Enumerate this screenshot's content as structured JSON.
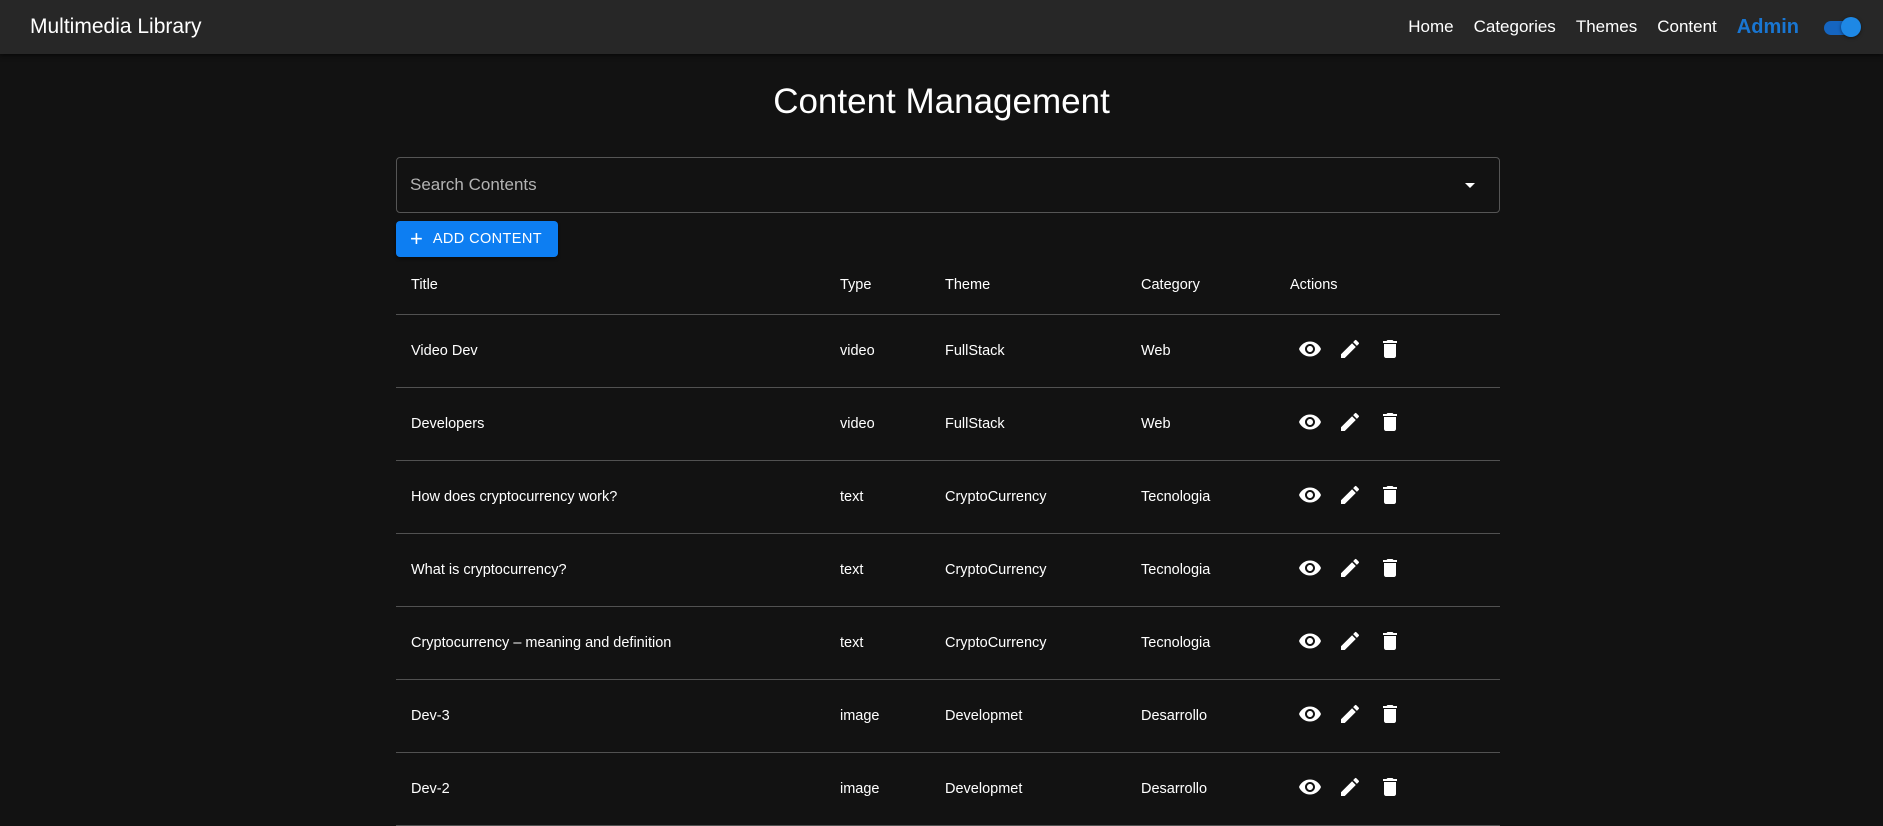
{
  "appbar": {
    "brand": "Multimedia Library",
    "nav": [
      "Home",
      "Categories",
      "Themes",
      "Content"
    ],
    "admin_label": "Admin",
    "theme_toggle_on": true
  },
  "page": {
    "title": "Content Management"
  },
  "search": {
    "placeholder": "Search Contents"
  },
  "add_button": {
    "icon": "plus-icon",
    "label": "ADD CONTENT"
  },
  "table": {
    "headers": [
      "Title",
      "Type",
      "Theme",
      "Category",
      "Actions"
    ],
    "action_icons": [
      "eye-icon",
      "pencil-icon",
      "trash-icon"
    ],
    "rows": [
      {
        "title": "Video Dev",
        "type": "video",
        "theme": "FullStack",
        "category": "Web"
      },
      {
        "title": "Developers",
        "type": "video",
        "theme": "FullStack",
        "category": "Web"
      },
      {
        "title": "How does cryptocurrency work?",
        "type": "text",
        "theme": "CryptoCurrency",
        "category": "Tecnologia"
      },
      {
        "title": "What is cryptocurrency?",
        "type": "text",
        "theme": "CryptoCurrency",
        "category": "Tecnologia"
      },
      {
        "title": "Cryptocurrency – meaning and definition",
        "type": "text",
        "theme": "CryptoCurrency",
        "category": "Tecnologia"
      },
      {
        "title": "Dev-3",
        "type": "image",
        "theme": "Developmet",
        "category": "Desarrollo"
      },
      {
        "title": "Dev-2",
        "type": "image",
        "theme": "Developmet",
        "category": "Desarrollo"
      }
    ]
  }
}
